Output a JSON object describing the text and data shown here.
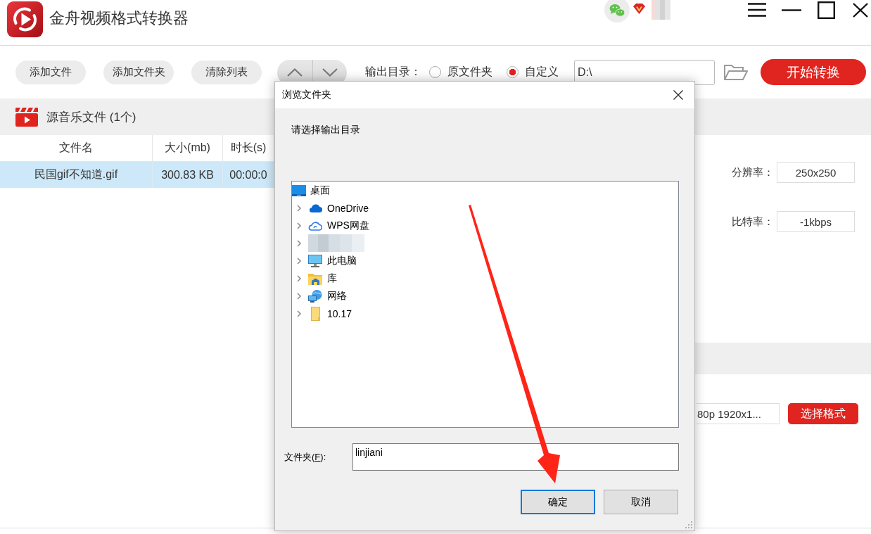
{
  "app": {
    "title": "金舟视频格式转换器"
  },
  "toolbar": {
    "buttons": [
      "添加文件",
      "添加文件夹",
      "清除列表"
    ],
    "output_dir": {
      "label": "输出目录：",
      "options": [
        {
          "label": "原文件夹",
          "selected": false
        },
        {
          "label": "自定义",
          "selected": true
        }
      ],
      "path": "D:\\"
    },
    "start_button": "开始转换"
  },
  "file_list": {
    "title": "源音乐文件 (1个)",
    "columns": [
      "文件名",
      "大小(mb)",
      "时长(s)"
    ],
    "rows": [
      {
        "cells": [
          "民国gif不知道.gif",
          "300.83 KB",
          "00:00:0"
        ],
        "selected": true
      }
    ]
  },
  "settings": {
    "rows": [
      {
        "label": "分辨率：",
        "value": "250x250"
      },
      {
        "label": "比特率：",
        "value": "-1kbps"
      }
    ],
    "format": {
      "value": "80p 1920x1...",
      "button": "选择格式"
    }
  },
  "dialog": {
    "title": "浏览文件夹",
    "prompt": "请选择输出目录",
    "tree": [
      {
        "label": "桌面",
        "kind": "desktop",
        "children": [
          {
            "label": "OneDrive",
            "kind": "cloud",
            "expanded": false
          },
          {
            "label": "WPS网盘",
            "kind": "cloud-outline",
            "expanded": false
          },
          {
            "kind": "redacted",
            "expanded": false
          },
          {
            "label": "此电脑",
            "kind": "computer",
            "expanded": false
          },
          {
            "label": "库",
            "kind": "library",
            "expanded": false
          },
          {
            "label": "网络",
            "kind": "network",
            "expanded": false
          },
          {
            "label": "10.17",
            "kind": "folder",
            "expanded": false
          }
        ]
      }
    ],
    "folder_field": {
      "label_before": "文件夹(",
      "accelerator": "F",
      "label_after": "):",
      "value": "linjiani"
    },
    "buttons": [
      {
        "label": "确定",
        "default": true
      },
      {
        "label": "取消",
        "default": false
      }
    ]
  }
}
